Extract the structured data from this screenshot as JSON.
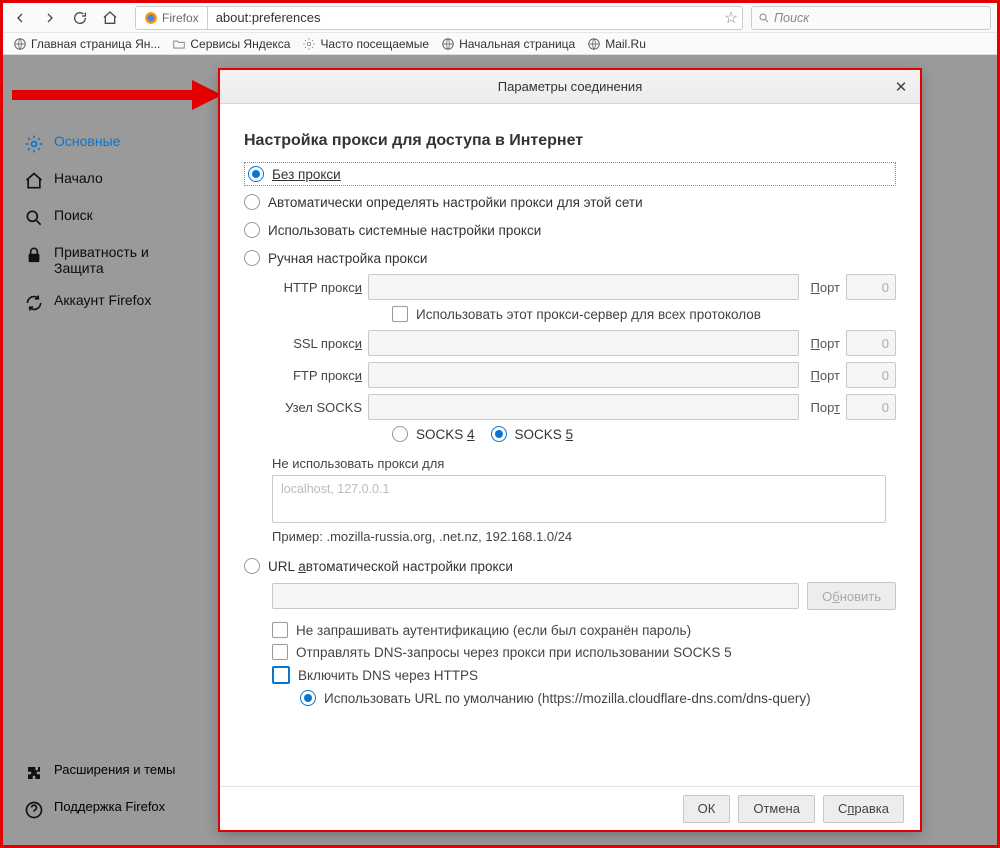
{
  "navbar": {
    "firefox_label": "Firefox",
    "url": "about:preferences",
    "search_placeholder": "Поиск"
  },
  "bookmarks": [
    "Главная страница Ян...",
    "Сервисы Яндекса",
    "Часто посещаемые",
    "Начальная страница",
    "Mail.Ru"
  ],
  "sidebar": {
    "items": [
      "Основные",
      "Начало",
      "Поиск",
      "Приватность и Защита",
      "Аккаунт Firefox"
    ],
    "bottom": [
      "Расширения и темы",
      "Поддержка Firefox"
    ]
  },
  "dialog": {
    "title": "Параметры соединения",
    "section": "Настройка прокси для доступа в Интернет",
    "radios": {
      "no_proxy_pre": "Без прокси",
      "auto_detect": "Автоматически определять настройки прокси для этой сети",
      "system": "Использовать системные настройки прокси",
      "manual": "Ручная настройка прокси",
      "auto_url_pre": "URL ",
      "auto_url_u": "а",
      "auto_url_post": "втоматической настройки прокси"
    },
    "labels": {
      "http": "HTTP прокси",
      "ssl": "SSL прокси",
      "ftp": "FTP прокси",
      "socks": "Узел SOCKS",
      "port": "Порт",
      "port_u": "П",
      "port_rest": "орт",
      "port_val": "0",
      "use_for_all": "Использовать этот прокси-сервер для всех протоколов",
      "socks4_pre": "SOCKS ",
      "socks4_u": "4",
      "socks5_pre": "SOCKS ",
      "socks5_u": "5",
      "no_proxy_for": "Не использовать прокси для",
      "no_proxy_placeholder": "localhost, 127.0.0.1",
      "example": "Пример: .mozilla-russia.org, .net.nz, 192.168.1.0/24",
      "reload_pre": "О",
      "reload_u": "б",
      "reload_post": "новить",
      "chk_noauth": "Не запрашивать аутентификацию (если был сохранён пароль)",
      "chk_dns_socks": "Отправлять DNS-запросы через прокси при использовании SOCKS 5",
      "chk_dns_https": "Включить DNS через HTTPS",
      "dns_default": "Использовать URL по умолчанию (https://mozilla.cloudflare-dns.com/dns-query)"
    },
    "buttons": {
      "ok": "ОК",
      "cancel": "Отмена",
      "help_pre": "С",
      "help_u": "п",
      "help_post": "равка"
    }
  }
}
